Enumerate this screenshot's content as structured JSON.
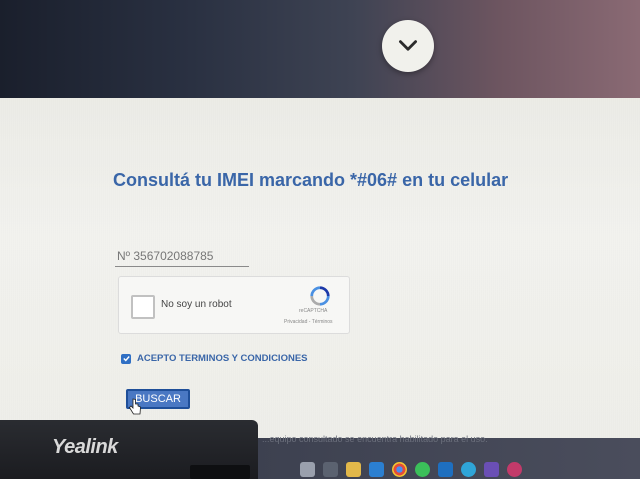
{
  "heading": "Consultá tu IMEI marcando *#06# en tu celular",
  "imei_input": {
    "value": "Nº 356702088785",
    "placeholder": "Nº"
  },
  "recaptcha": {
    "label": "No soy un robot",
    "brand": "reCAPTCHA",
    "links": "Privacidad - Términos"
  },
  "terms_checkbox": {
    "label": "ACEPTO TERMINOS Y CONDICIONES",
    "checked": true
  },
  "search_button": {
    "label": "BUSCAR"
  },
  "footer_notice": "...equipo consultado se encuentra habilitado para el uso.",
  "device_brand": "Yealink",
  "colors": {
    "accent": "#3a66a8",
    "button": "#4a78c3",
    "checkbox": "#2f6fc4"
  },
  "taskbar_icons": [
    "explorer-icon",
    "store-icon",
    "folder-icon",
    "edge-icon",
    "chrome-icon",
    "whatsapp-icon",
    "outlook-icon",
    "photos-icon",
    "app-icon",
    "settings-icon"
  ]
}
